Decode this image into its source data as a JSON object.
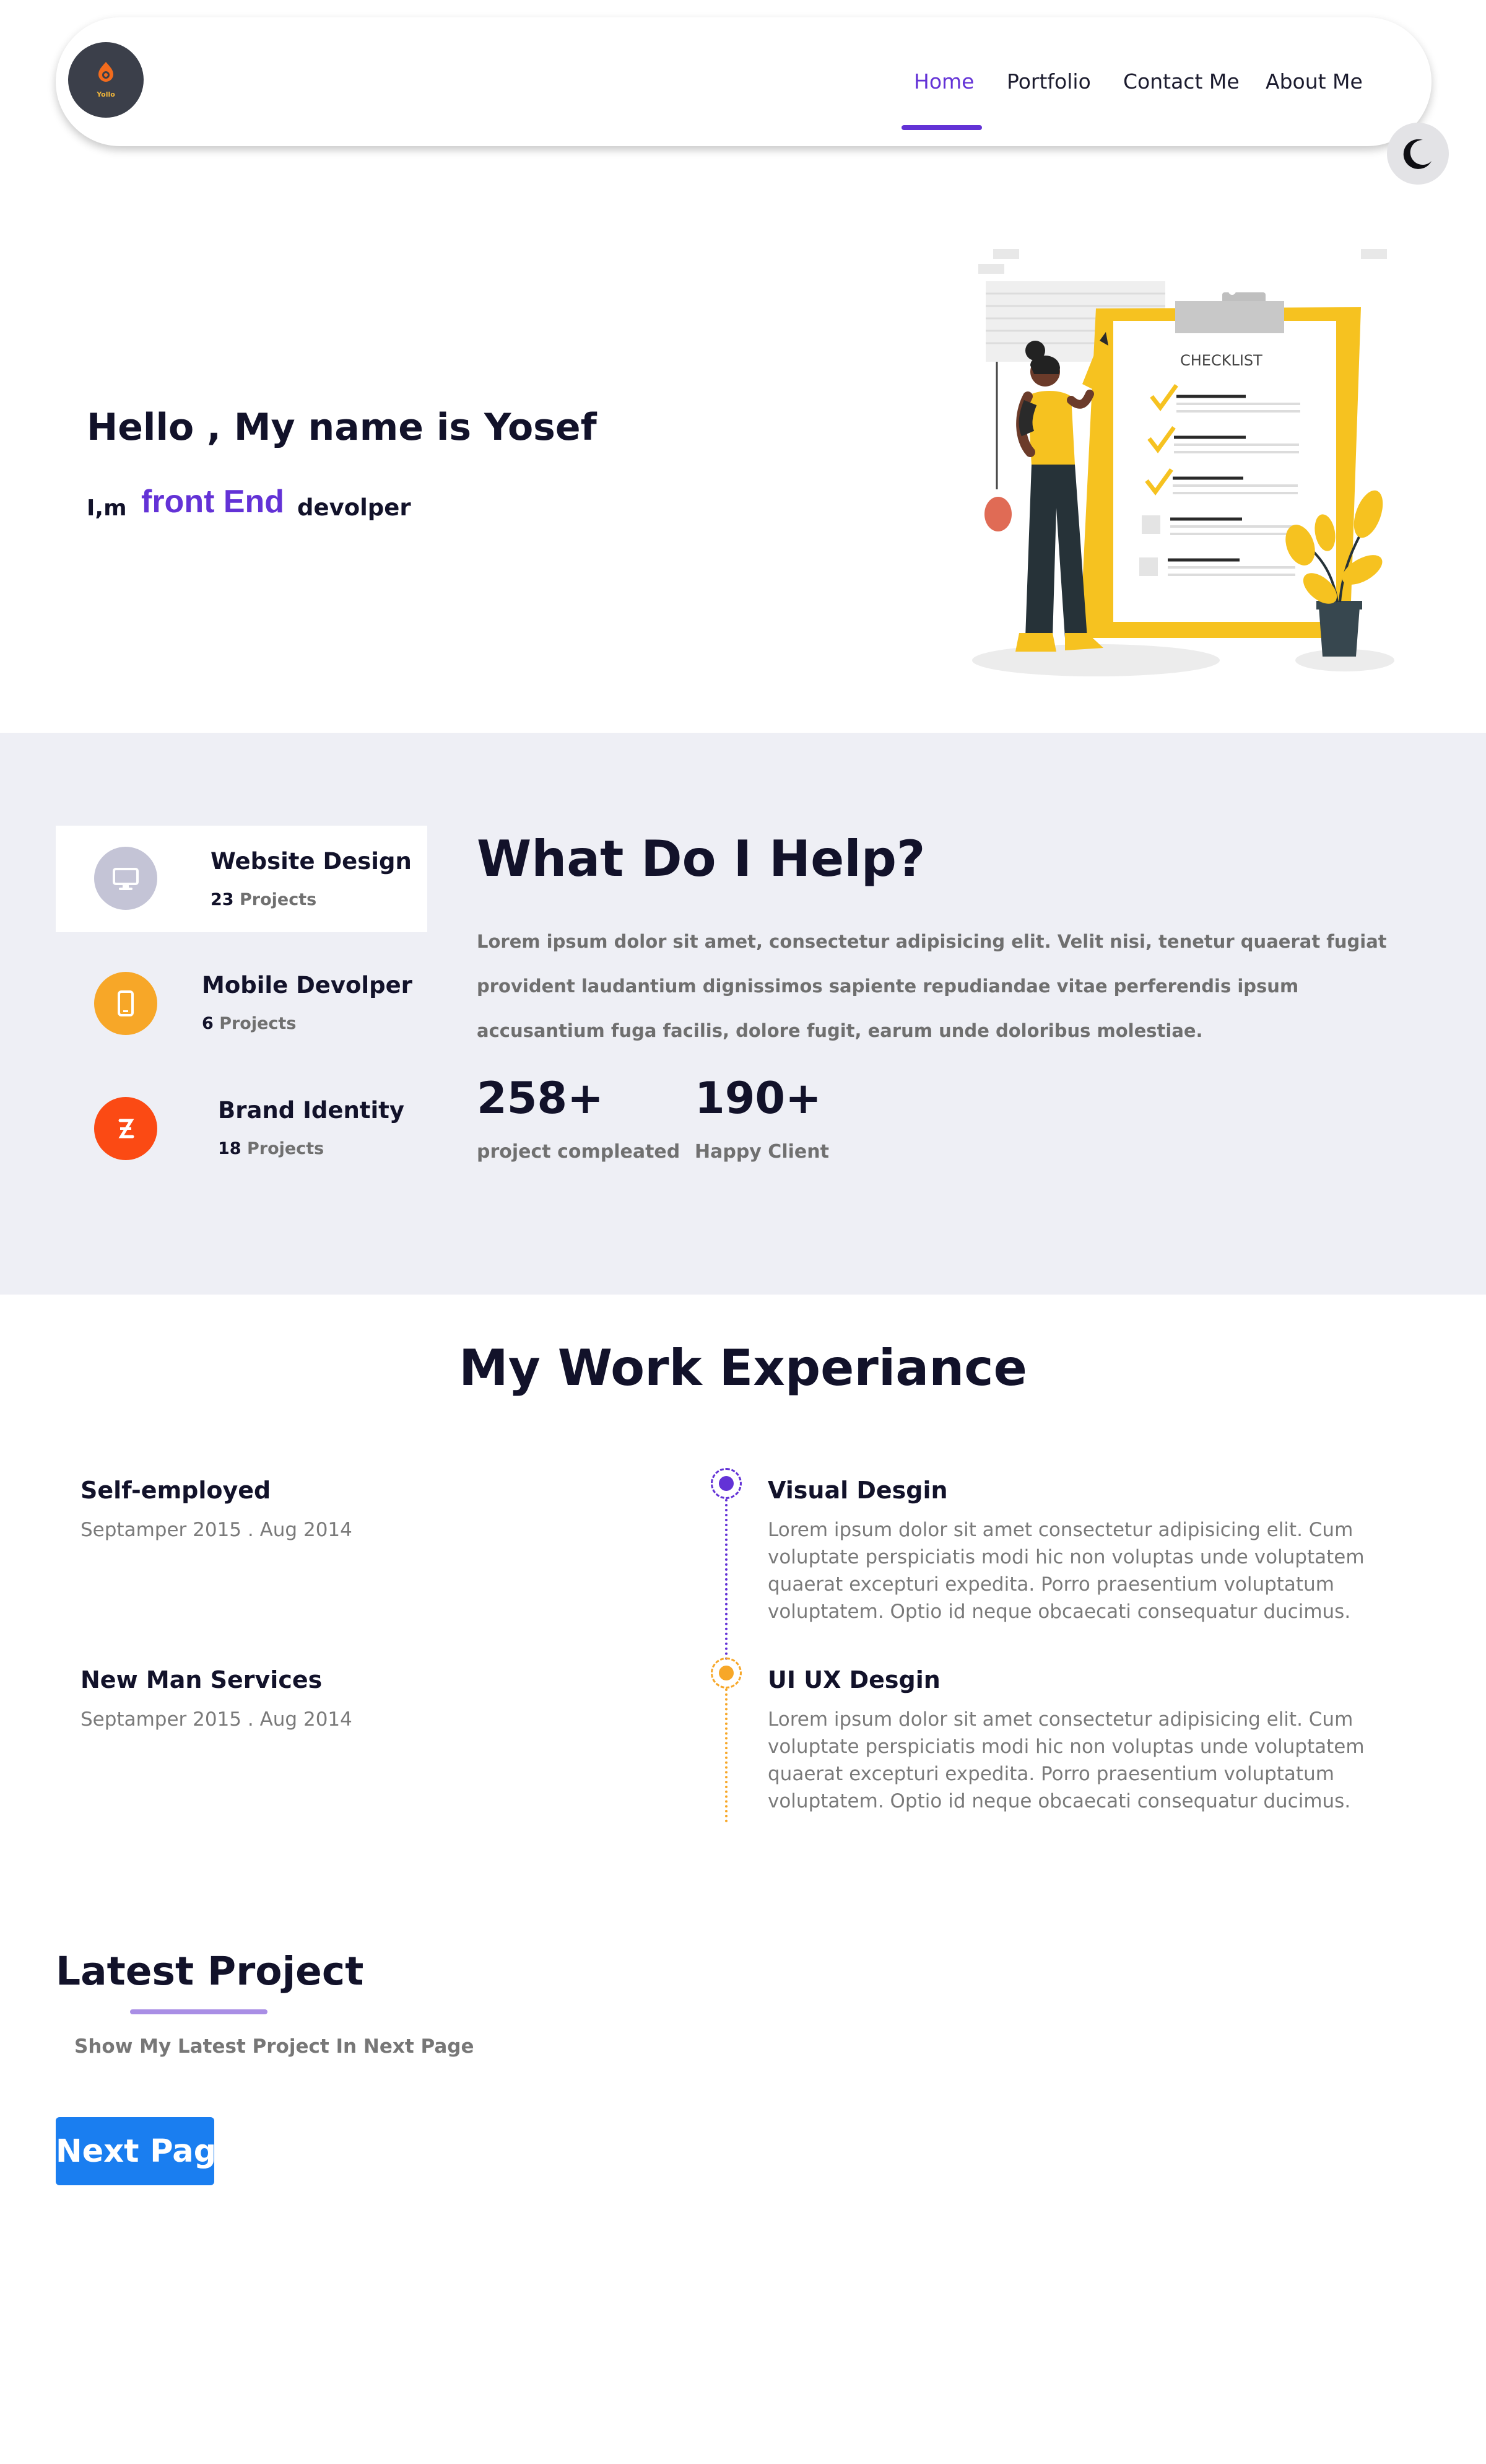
{
  "nav": {
    "logo_text": "Yollo",
    "links": [
      {
        "label": "Home",
        "active": true
      },
      {
        "label": "Portfolio",
        "active": false
      },
      {
        "label": "Contact Me",
        "active": false
      },
      {
        "label": "About Me",
        "active": false
      }
    ],
    "theme_icon": "moon-icon"
  },
  "hero": {
    "greeting": "Hello , My name is Yosef",
    "prefix": "I,m",
    "role": "front End",
    "suffix": "devolper",
    "illustration_text": "CHECKLIST"
  },
  "help": {
    "title": "What Do I Help?",
    "text": "Lorem ipsum dolor sit amet, consectetur adipisicing elit. Velit nisi, tenetur quaerat fugiat provident laudantium dignissimos sapiente repudiandae vitae perferendis ipsum accusantium fuga facilis, dolore fugit, earum unde doloribus molestiae.",
    "services": [
      {
        "title": "Website Design",
        "count": "23",
        "count_label": "Projects",
        "icon": "monitor-icon",
        "color": "#c4c4d6"
      },
      {
        "title": "Mobile Devolper",
        "count": "6",
        "count_label": "Projects",
        "icon": "mobile-icon",
        "color": "#f7a728"
      },
      {
        "title": "Brand Identity",
        "count": "18",
        "count_label": "Projects",
        "icon": "brand-icon",
        "color": "#fb4a14"
      }
    ],
    "stats": [
      {
        "value": "258+",
        "label": "project compleated"
      },
      {
        "value": "190+",
        "label": "Happy Client"
      }
    ]
  },
  "experience": {
    "title": "My Work Experiance",
    "items": [
      {
        "company": "Self-employed",
        "dates": "Septamper 2015 . Aug 2014",
        "role": "Visual Desgin",
        "description": "Lorem ipsum dolor sit amet consectetur adipisicing elit. Cum voluptate perspiciatis modi hic non voluptas unde voluptatem quaerat excepturi expedita. Porro praesentium voluptatum voluptatem. Optio id neque obcaecati consequatur ducimus.",
        "color": "#6332d6"
      },
      {
        "company": "New Man Services",
        "dates": "Septamper 2015 . Aug 2014",
        "role": "UI UX Desgin",
        "description": "Lorem ipsum dolor sit amet consectetur adipisicing elit. Cum voluptate perspiciatis modi hic non voluptas unde voluptatem quaerat excepturi expedita. Porro praesentium voluptatum voluptatem. Optio id neque obcaecati consequatur ducimus.",
        "color": "#f7a728"
      }
    ]
  },
  "latest": {
    "title": "Latest Project",
    "subtitle": "Show My Latest Project In Next Page",
    "button": "Next Page"
  },
  "colors": {
    "accent": "#6332d6",
    "button": "#1a7ef0",
    "section_bg": "#eeeff5"
  }
}
